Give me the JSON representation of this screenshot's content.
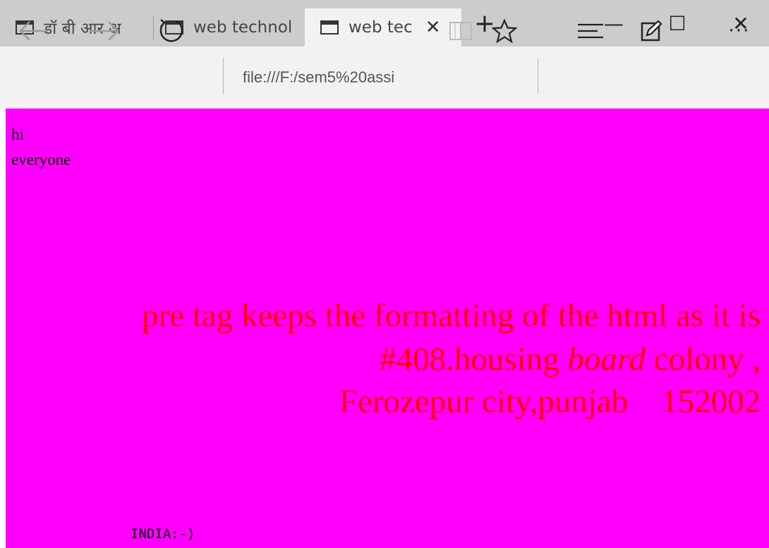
{
  "tabs": [
    {
      "title": "डॉ बी आर अ"
    },
    {
      "title": "web technol"
    },
    {
      "title": "web tec",
      "active": true
    }
  ],
  "window_controls": {
    "new_tab": "+",
    "minimize": "—",
    "maximize": "☐",
    "close": "✕"
  },
  "toolbar": {
    "address": "file:///F:/sem5%20assi",
    "back_icon": "arrow-left-icon",
    "forward_icon": "arrow-right-icon",
    "refresh_icon": "refresh-icon",
    "reading_icon": "book-icon",
    "favorite_icon": "star-icon",
    "hub_icon": "hub-icon",
    "note_icon": "note-icon",
    "more_label": "···"
  },
  "page": {
    "line1": "hi",
    "line2": "everyone",
    "pre_line1": "pre tag keeps the formatting of the html as it is",
    "pre_line2_a": "#408.housing ",
    "pre_line2_em": "board",
    "pre_line2_b": " colony ,",
    "pre_line3": "Ferozepur city,punjab    152002",
    "mono_text": "INDIA:-)",
    "background_color": "#ff00ff",
    "text_color": "#ff0000"
  }
}
